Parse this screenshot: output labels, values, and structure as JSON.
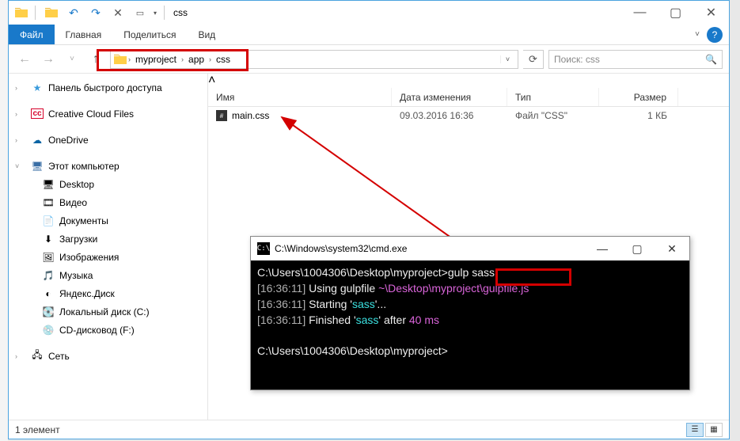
{
  "window": {
    "title": "css",
    "controls": {
      "min": "—",
      "max": "▢",
      "close": "✕"
    }
  },
  "ribbon": {
    "file": "Файл",
    "home": "Главная",
    "share": "Поделиться",
    "view": "Вид"
  },
  "address": {
    "back": "←",
    "fwd": "→",
    "up": "↑",
    "recent": "˅",
    "crumbs": [
      "myproject",
      "app",
      "css"
    ],
    "refresh": "⟳"
  },
  "search": {
    "placeholder": "Поиск: css"
  },
  "columns": {
    "name": "Имя",
    "date": "Дата изменения",
    "type": "Тип",
    "size": "Размер"
  },
  "files": [
    {
      "name": "main.css",
      "date": "09.03.2016 16:36",
      "type": "Файл \"CSS\"",
      "size": "1 КБ"
    }
  ],
  "sidebar": {
    "quick": "Панель быстрого доступа",
    "cc": "Creative Cloud Files",
    "od": "OneDrive",
    "pc": "Этот компьютер",
    "pc_items": [
      "Desktop",
      "Видео",
      "Документы",
      "Загрузки",
      "Изображения",
      "Музыка",
      "Яндекс.Диск",
      "Локальный диск (C:)",
      "CD-дисковод (F:)"
    ],
    "net": "Сеть"
  },
  "status": {
    "count": "1 элемент"
  },
  "cmd": {
    "title": "C:\\Windows\\system32\\cmd.exe",
    "prompt1_path": "C:\\Users\\1004306\\Desktop\\myproject>",
    "prompt1_cmd": "gulp sass",
    "line2_time": "[16:36:11]",
    "line2_text": " Using gulpfile ",
    "line2_path": "~\\Desktop\\myproject\\gulpfile.js",
    "line3_time": "[16:36:11]",
    "line3_text": " Starting '",
    "line3_task": "sass",
    "line3_end": "'...",
    "line4_time": "[16:36:11]",
    "line4_text": " Finished '",
    "line4_task": "sass",
    "line4_mid": "' after ",
    "line4_dur": "40 ms",
    "prompt2": "C:\\Users\\1004306\\Desktop\\myproject>"
  }
}
